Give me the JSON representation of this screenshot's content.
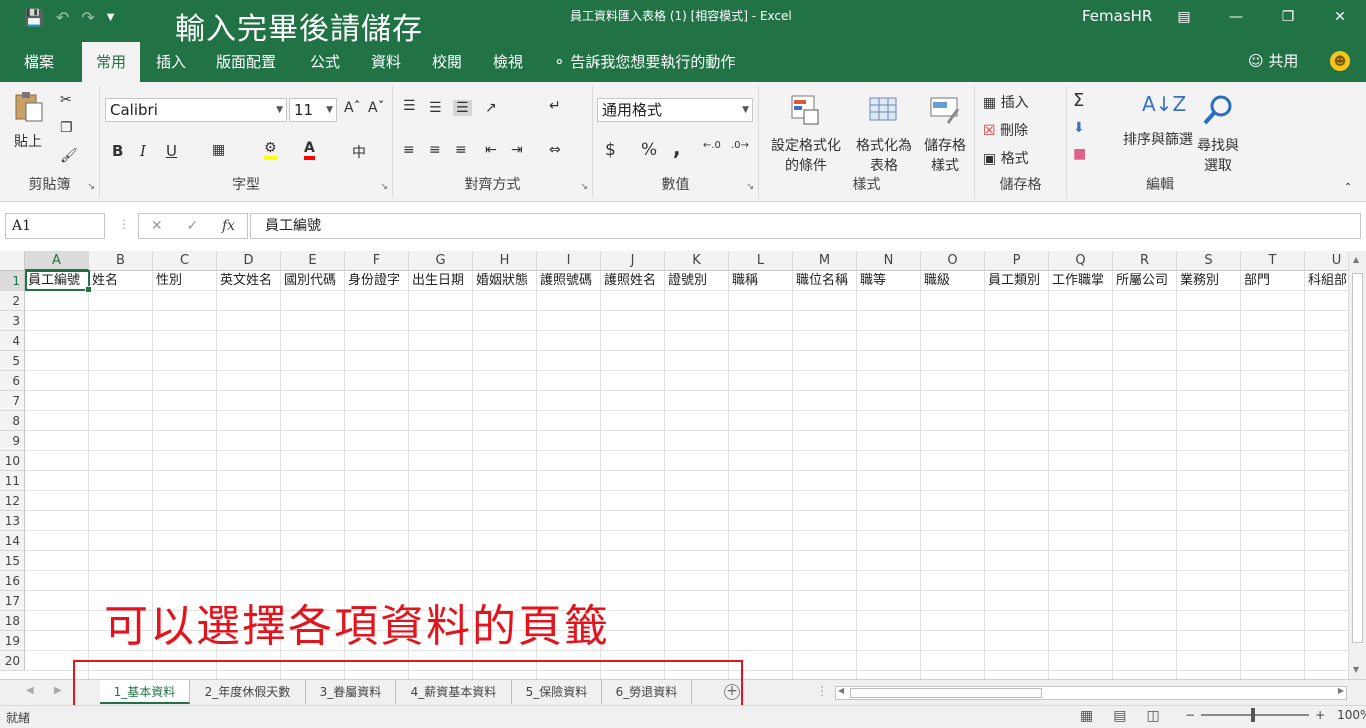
{
  "window": {
    "overlay_title": "輸入完畢後請儲存",
    "doc_title": "員工資料匯入表格 (1) [相容模式] - Excel",
    "user": "FemasHR"
  },
  "ribbon_tabs": [
    "檔案",
    "常用",
    "插入",
    "版面配置",
    "公式",
    "資料",
    "校閱",
    "檢視"
  ],
  "active_tab": "常用",
  "tell_me": "告訴我您想要執行的動作",
  "share": "共用",
  "clipboard": {
    "paste": "貼上",
    "label": "剪貼簿"
  },
  "font": {
    "name": "Calibri",
    "size": "11",
    "label": "字型",
    "bold": "B",
    "italic": "I",
    "underline": "U",
    "phonetic": "中"
  },
  "alignment": {
    "label": "對齊方式"
  },
  "number": {
    "format": "通用格式",
    "label": "數值",
    "currency": "$",
    "percent": "%",
    "comma": ","
  },
  "styles": {
    "conditional": [
      "設定格式化",
      "的條件"
    ],
    "as_table": [
      "格式化為",
      "表格"
    ],
    "cell_styles": [
      "儲存格",
      "樣式"
    ],
    "label": "樣式"
  },
  "cells": {
    "insert": "插入",
    "delete": "刪除",
    "format": "格式",
    "label": "儲存格"
  },
  "editing": {
    "sort": [
      "排序與篩選"
    ],
    "find": [
      "尋找與",
      "選取"
    ],
    "label": "編輯"
  },
  "formula_bar": {
    "name_box": "A1",
    "content": "員工編號"
  },
  "columns": [
    "A",
    "B",
    "C",
    "D",
    "E",
    "F",
    "G",
    "H",
    "I",
    "J",
    "K",
    "L",
    "M",
    "N",
    "O",
    "P",
    "Q",
    "R",
    "S",
    "T",
    "U"
  ],
  "header_row": [
    "員工編號",
    "姓名",
    "性別",
    "英文姓名",
    "國別代碼",
    "身份證字",
    "出生日期",
    "婚姻狀態",
    "護照號碼",
    "護照姓名",
    "證號別",
    "職稱",
    "職位名稱",
    "職等",
    "職級",
    "員工類別",
    "工作職掌",
    "所屬公司",
    "業務別",
    "部門",
    "科組部"
  ],
  "rows": [
    "1",
    "2",
    "3",
    "4",
    "5",
    "6",
    "7",
    "8",
    "9",
    "10",
    "11",
    "12",
    "13",
    "14",
    "15",
    "16",
    "17",
    "18",
    "19",
    "20"
  ],
  "annotation": "可以選擇各項資料的頁籤",
  "sheet_tabs": [
    "1_基本資料",
    "2_年度休假天數",
    "3_眷屬資料",
    "4_薪資基本資料",
    "5_保險資料",
    "6_勞退資料"
  ],
  "active_sheet": 0,
  "status": {
    "ready": "就緒",
    "zoom": "100%"
  },
  "colors": {
    "accent": "#217346",
    "annotation": "#e3141b"
  }
}
